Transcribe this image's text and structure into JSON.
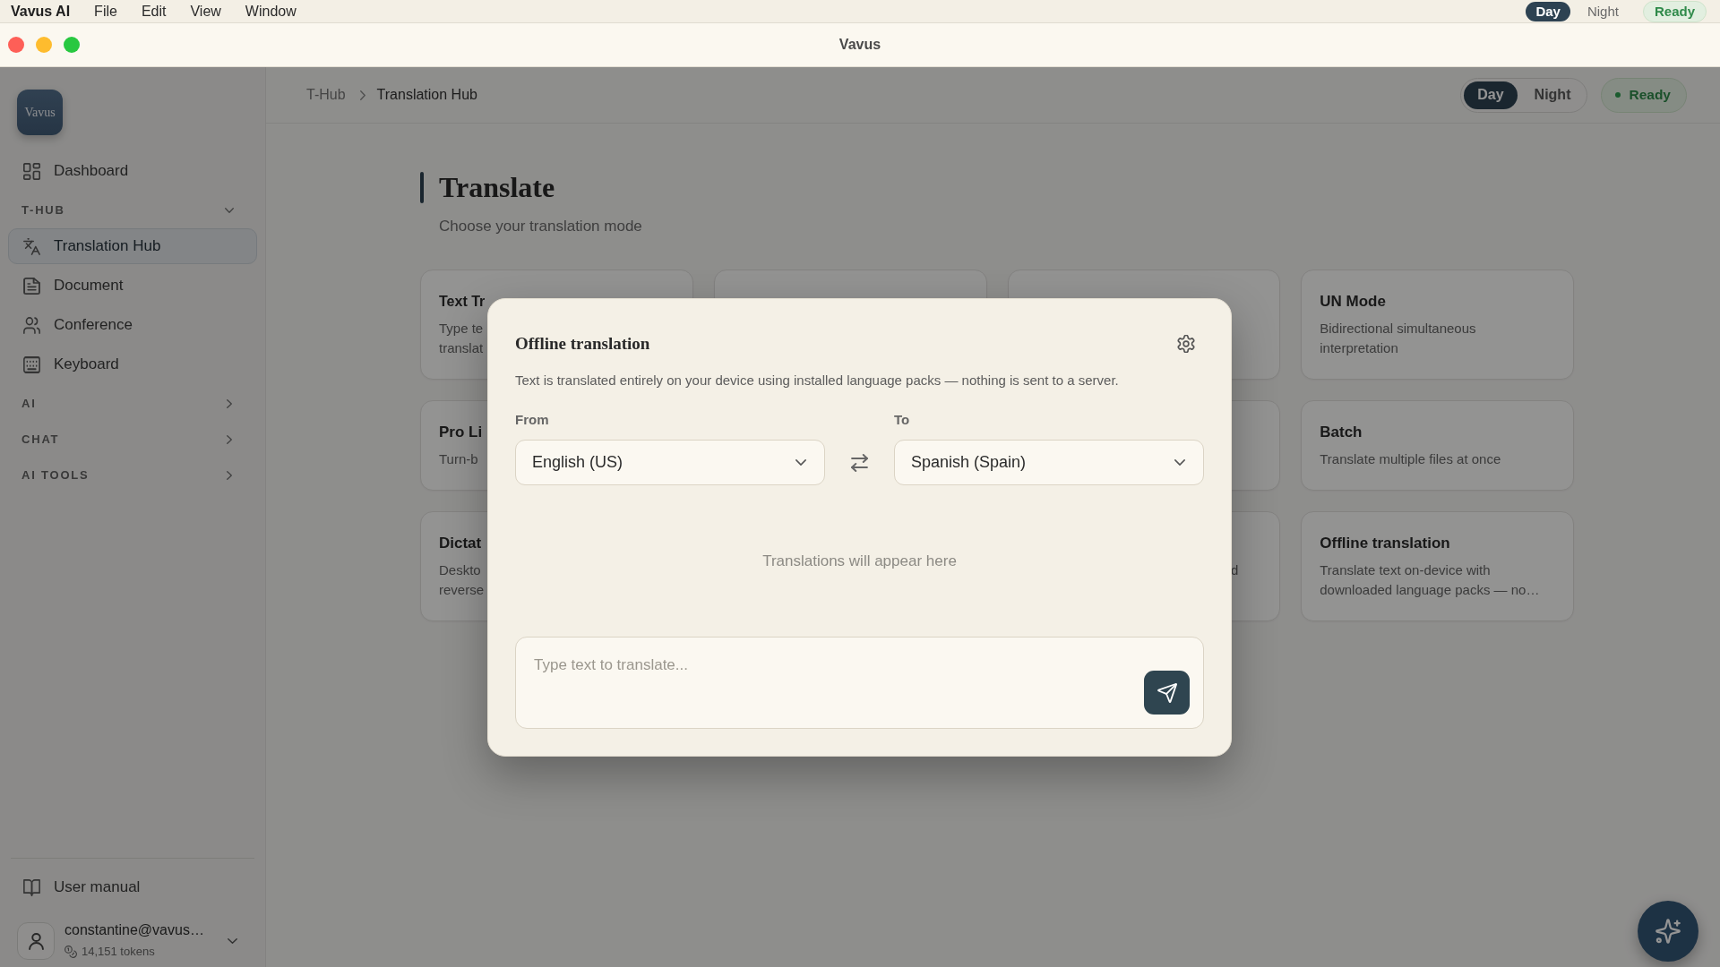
{
  "menu_bar": {
    "app_name": "Vavus AI",
    "menus": [
      "File",
      "Edit",
      "View",
      "Window"
    ],
    "theme_toggle": [
      {
        "label": "Day",
        "selected": true
      },
      {
        "label": "Night",
        "selected": false
      }
    ],
    "status": "Ready"
  },
  "window": {
    "title": "Vavus"
  },
  "sidebar": {
    "logo": "Vavus",
    "items": [
      {
        "kind": "link",
        "label": "Dashboard",
        "selected": false
      },
      {
        "kind": "section",
        "label": "T-HUB",
        "expanded": true,
        "children": [
          {
            "label": "Translation Hub",
            "selected": true
          },
          {
            "label": "Document",
            "selected": false
          },
          {
            "label": "Conference",
            "selected": false
          },
          {
            "label": "Keyboard",
            "selected": false
          }
        ]
      },
      {
        "kind": "section",
        "label": "AI",
        "expanded": false
      },
      {
        "kind": "section",
        "label": "CHAT",
        "expanded": false
      },
      {
        "kind": "section",
        "label": "AI TOOLS",
        "expanded": false
      }
    ],
    "manual_link": "User manual",
    "user": {
      "email": "constantine@vavus…",
      "tokens": "14,151 tokens"
    }
  },
  "header": {
    "breadcrumb": [
      "T-Hub",
      "Translation Hub"
    ],
    "theme_toggle": [
      {
        "label": "Day",
        "selected": true
      },
      {
        "label": "Night",
        "selected": false
      }
    ],
    "status": "Ready"
  },
  "page": {
    "title": "Translate",
    "subtitle": "Choose your translation mode",
    "mode_cards": [
      {
        "kind": "mode",
        "title": "Text Tr",
        "description_lines": [
          "Type te",
          "translat"
        ]
      },
      {
        "kind": "blank"
      },
      {
        "kind": "blank"
      },
      {
        "kind": "mode",
        "title": "UN Mode",
        "description_lines": [
          "Bidirectional simultaneous",
          "interpretation"
        ]
      },
      {
        "kind": "mode",
        "title": "Pro Li",
        "description_lines": [
          "Turn-b"
        ]
      },
      {
        "kind": "blank"
      },
      {
        "kind": "blank"
      },
      {
        "kind": "mode",
        "title": "Batch",
        "description_lines": [
          "Translate multiple files at once"
        ]
      },
      {
        "kind": "mode",
        "title": "Dictat",
        "description_lines": [
          "Deskto",
          "reverse"
        ]
      },
      {
        "kind": "blank"
      },
      {
        "kind": "tail",
        "description_lines": [
          "d"
        ]
      },
      {
        "kind": "mode",
        "title": "Offline translation",
        "description_lines": [
          "Translate text on-device with",
          "downloaded language packs — no…"
        ]
      }
    ]
  },
  "dialog": {
    "title": "Offline translation",
    "description": "Text is translated entirely on your device using installed language packs — nothing is sent to a server.",
    "source_language": {
      "label": "From",
      "value": "English (US)"
    },
    "target_language": {
      "label": "To",
      "value": "Spanish (Spain)"
    },
    "empty_state": "Translations will appear here",
    "input": {
      "placeholder": "Type text to translate..."
    }
  }
}
